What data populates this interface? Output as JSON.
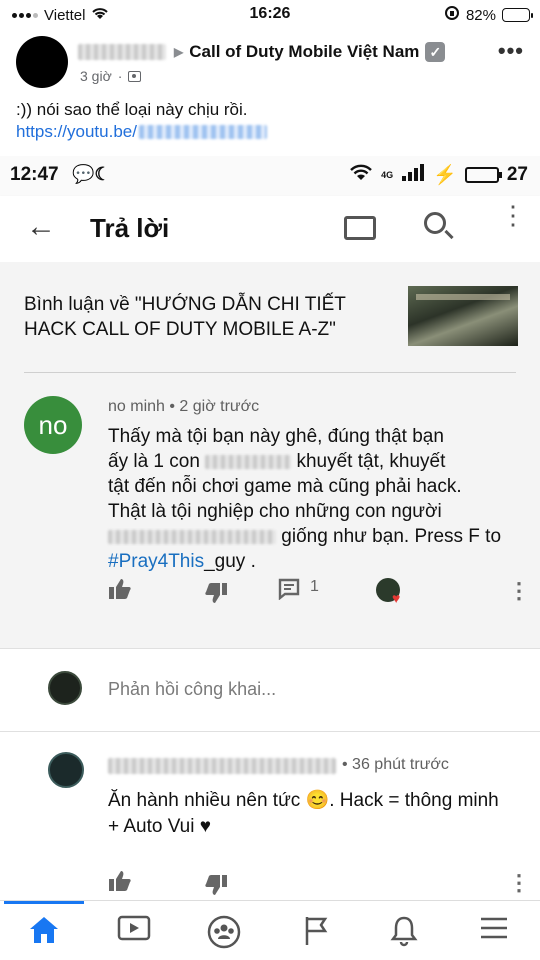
{
  "ios_status": {
    "carrier": "Viettel",
    "time": "16:26",
    "battery": "82%"
  },
  "post": {
    "group": "Call of Duty Mobile Việt Nam",
    "time": "3 giờ",
    "text": ":)) nói sao thể loại này chịu rồi.",
    "link_prefix": "https://youtu.be/"
  },
  "android_status": {
    "time": "12:47",
    "battery": "27",
    "network": "4G"
  },
  "toolbar": {
    "title": "Trả lời"
  },
  "video": {
    "about": "Bình luận về \"HƯỚNG DẪN CHI TIẾT HACK CALL OF DUTY MOBILE A-Z\""
  },
  "comment": {
    "avatar_text": "no",
    "meta": "no minh • 2 giờ trước",
    "line1": "Thấy mà tội bạn này ghê, đúng thật bạn",
    "line2_a": "ấy là 1 con",
    "line2_b": "khuyết tật, khuyết",
    "line3": "tật đến nỗi chơi game mà cũng phải hack.",
    "line4": "Thật là tội nghiệp cho những con người",
    "line5_b": "giống như bạn. Press F to",
    "hashtag": "#Pray4This",
    "line6_rest": "_guy .",
    "reply_count": "1"
  },
  "reply_input": {
    "placeholder": "Phản hồi công khai..."
  },
  "reply": {
    "time": "• 36 phút trước",
    "text": "Ăn hành nhiều nên tức 😊. Hack = thông minh + Auto Vui ♥"
  },
  "colors": {
    "accent": "#1877f2",
    "avatar_green": "#388e3c",
    "hashtag": "#1a6fc0"
  }
}
